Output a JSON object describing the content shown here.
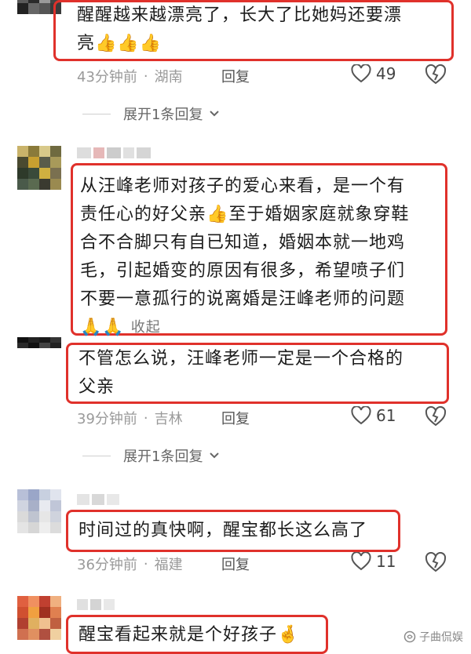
{
  "comments": [
    {
      "text_line1": "醒醒越来越漂亮了，长大了比她妈还要漂",
      "text_line2": "亮",
      "emoji": "👍👍👍",
      "time": "43分钟前",
      "location": "湖南",
      "reply_label": "回复",
      "likes": "49",
      "expand_label": "展开1条回复"
    },
    {
      "lines": [
        "从汪峰老师对孩子的爱心来看，是一个有",
        "责任心的好父亲",
        "合不合脚只有自已知道，婚姻本就一地鸡",
        "毛，引起婚变的原因有很多，希望喷子们",
        "不要一意孤行的说离婚是汪峰老师的问题"
      ],
      "line2_suffix": "至于婚姻家庭就象穿鞋",
      "emoji_thumb": "👍",
      "emoji_pray": "🙏🙏",
      "collapse_label": "收起"
    },
    {
      "text_line1": "不管怎么说，汪峰老师一定是一个合格的",
      "text_line2": "父亲",
      "time": "39分钟前",
      "location": "吉林",
      "reply_label": "回复",
      "likes": "61",
      "expand_label": "展开1条回复"
    },
    {
      "text": "时间过的真快啊，醒宝都长这么高了",
      "time": "36分钟前",
      "location": "福建",
      "reply_label": "回复",
      "likes": "11"
    },
    {
      "text": "醒宝看起来就是个好孩子",
      "emoji": "🤞"
    }
  ],
  "watermark": "子曲侃娱",
  "colors": {
    "highlight": "#e0312b",
    "meta": "#9a9a9a"
  }
}
